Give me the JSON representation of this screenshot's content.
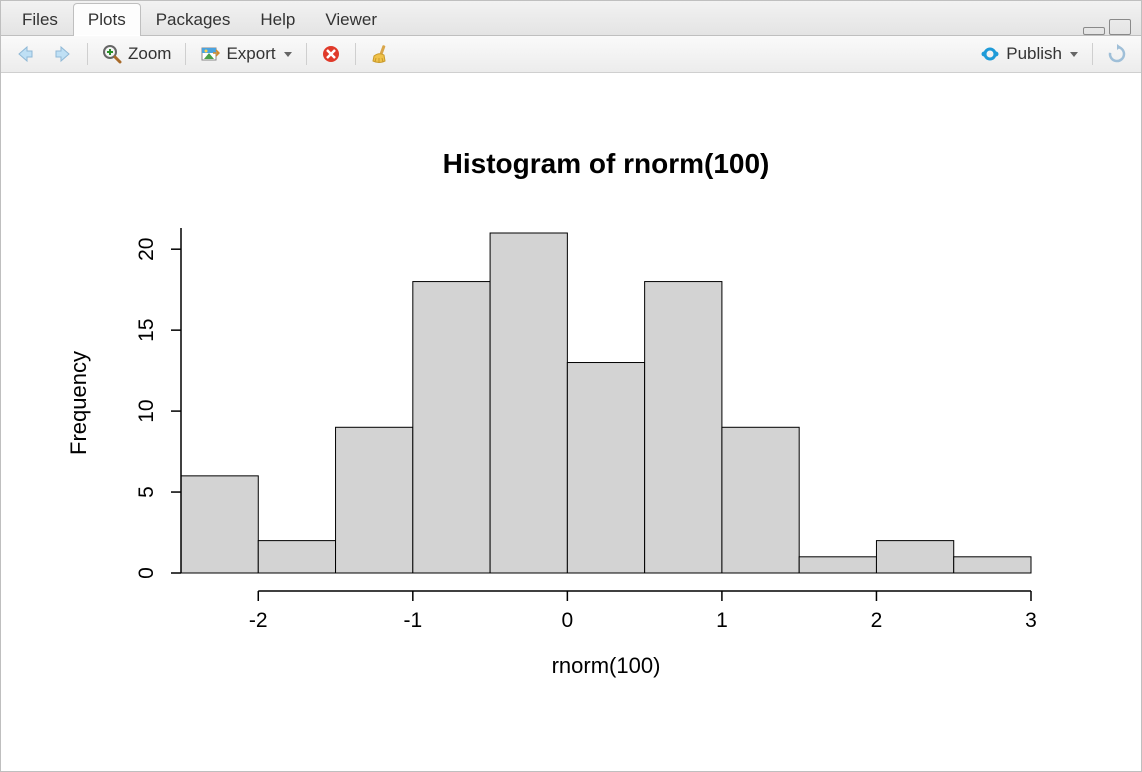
{
  "tabs": {
    "items": [
      {
        "label": "Files",
        "active": false
      },
      {
        "label": "Plots",
        "active": true
      },
      {
        "label": "Packages",
        "active": false
      },
      {
        "label": "Help",
        "active": false
      },
      {
        "label": "Viewer",
        "active": false
      }
    ]
  },
  "toolbar": {
    "zoom_label": "Zoom",
    "export_label": "Export",
    "publish_label": "Publish"
  },
  "chart_data": {
    "type": "bar",
    "title": "Histogram of rnorm(100)",
    "xlabel": "rnorm(100)",
    "ylabel": "Frequency",
    "bin_edges": [
      -2.5,
      -2.0,
      -1.5,
      -1.0,
      -0.5,
      0.0,
      0.5,
      1.0,
      1.5,
      2.0,
      2.5,
      3.0
    ],
    "values": [
      6,
      2,
      9,
      18,
      21,
      13,
      18,
      9,
      1,
      2,
      1
    ],
    "x_ticks": [
      -2,
      -1,
      0,
      1,
      2,
      3
    ],
    "y_ticks": [
      0,
      5,
      10,
      15,
      20
    ],
    "xlim": [
      -2.5,
      3.0
    ],
    "ylim": [
      0,
      21
    ]
  }
}
